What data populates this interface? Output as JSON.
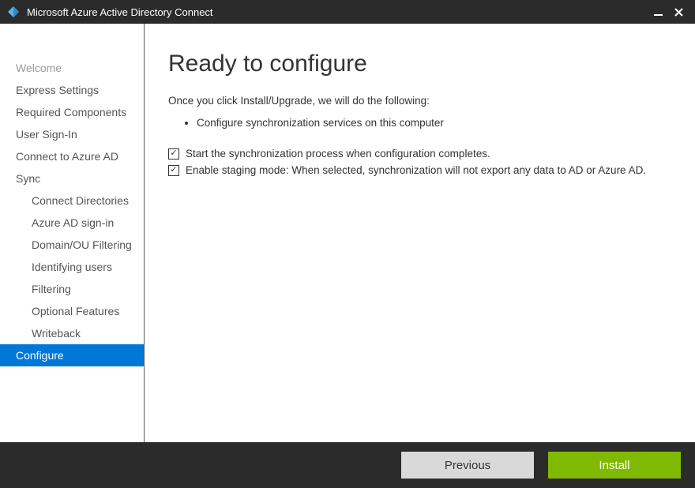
{
  "window": {
    "title": "Microsoft Azure Active Directory Connect"
  },
  "sidebar": {
    "items": [
      {
        "label": "Welcome",
        "visited": true
      },
      {
        "label": "Express Settings"
      },
      {
        "label": "Required Components"
      },
      {
        "label": "User Sign-In"
      },
      {
        "label": "Connect to Azure AD"
      },
      {
        "label": "Sync"
      },
      {
        "label": "Connect Directories",
        "sub": true
      },
      {
        "label": "Azure AD sign-in",
        "sub": true
      },
      {
        "label": "Domain/OU Filtering",
        "sub": true
      },
      {
        "label": "Identifying users",
        "sub": true
      },
      {
        "label": "Filtering",
        "sub": true
      },
      {
        "label": "Optional Features",
        "sub": true
      },
      {
        "label": "Writeback",
        "sub": true
      },
      {
        "label": "Configure",
        "active": true
      }
    ]
  },
  "main": {
    "heading": "Ready to configure",
    "intro": "Once you click Install/Upgrade, we will do the following:",
    "bullets": [
      "Configure synchronization services on this computer"
    ],
    "checkboxes": [
      {
        "checked": true,
        "label": "Start the synchronization process when configuration completes."
      },
      {
        "checked": true,
        "label": "Enable staging mode: When selected, synchronization will not export any data to AD or Azure AD."
      }
    ]
  },
  "footer": {
    "previous": "Previous",
    "install": "Install"
  }
}
